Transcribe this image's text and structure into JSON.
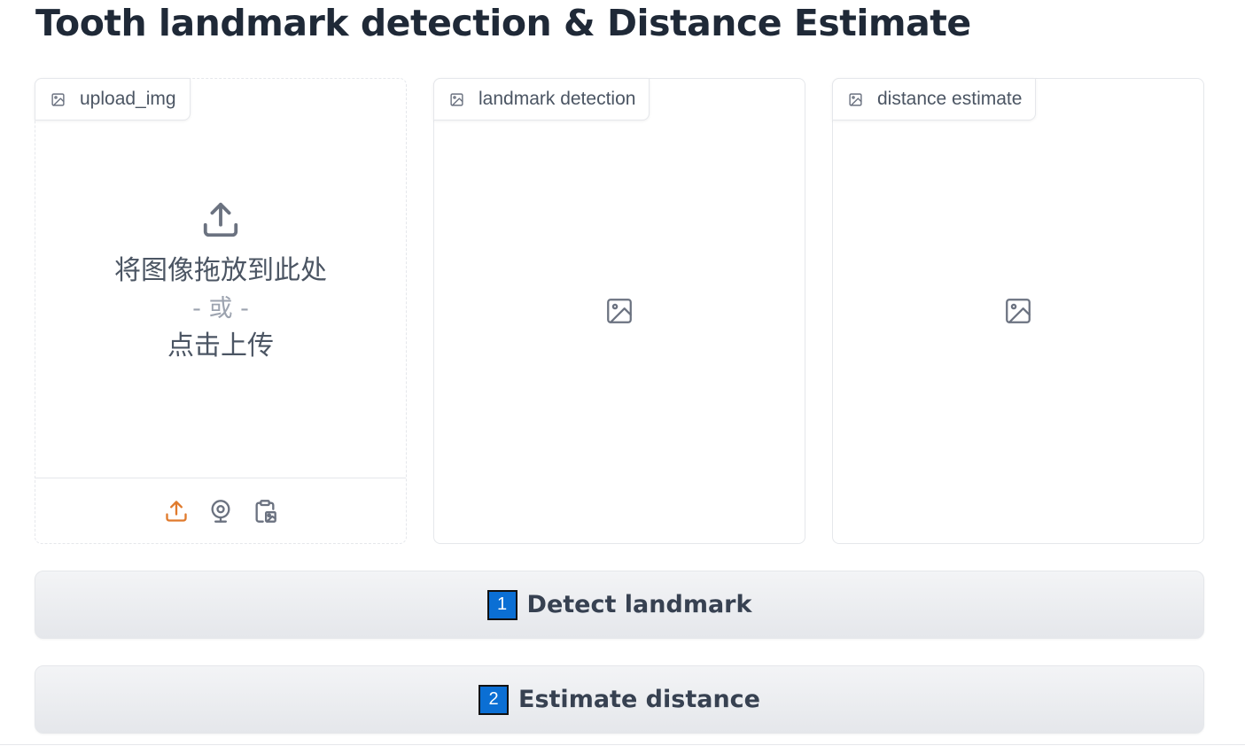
{
  "title": "Tooth landmark detection & Distance Estimate",
  "panels": {
    "upload": {
      "label": "upload_img",
      "drop_text": "将图像拖放到此处",
      "or_text": "- 或 -",
      "click_text": "点击上传",
      "sources": [
        "upload-icon",
        "webcam-icon",
        "clipboard-icon"
      ]
    },
    "landmark": {
      "label": "landmark detection"
    },
    "distance": {
      "label": "distance estimate"
    }
  },
  "buttons": {
    "detect": {
      "badge": "1",
      "label": "Detect landmark"
    },
    "estimate": {
      "badge": "2",
      "label": "Estimate distance"
    }
  },
  "colors": {
    "accent_orange": "#e07a2c",
    "badge_blue": "#0b6fd4",
    "icon_gray": "#6b7280",
    "title_text": "#1f2937"
  }
}
